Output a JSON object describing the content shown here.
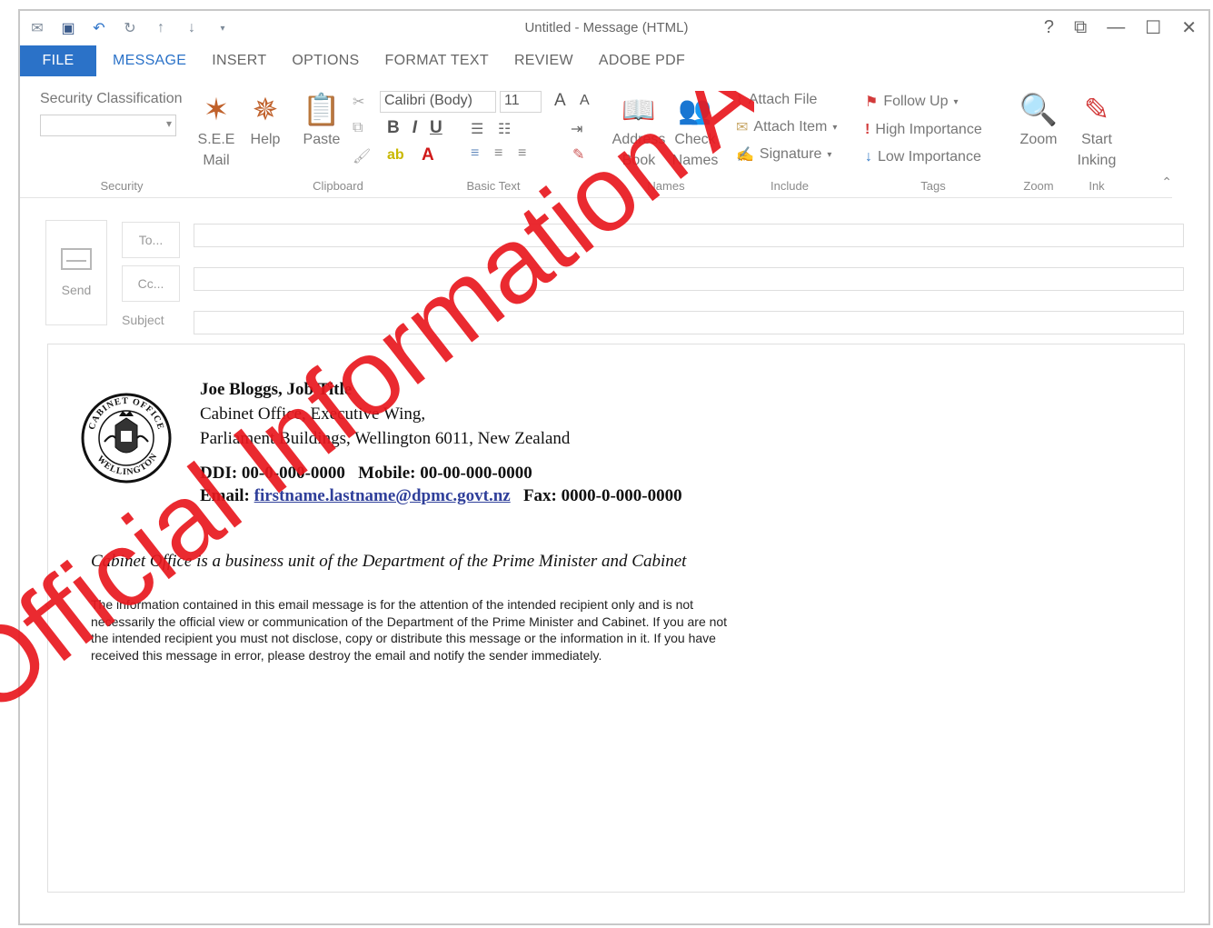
{
  "window": {
    "title": "Untitled - Message (HTML)",
    "controls": [
      "?",
      "⧉",
      "—",
      "☐",
      "✕"
    ]
  },
  "quick_access": [
    "envelope-icon",
    "save-icon",
    "undo-icon",
    "redo-icon",
    "up-arrow-icon",
    "down-arrow-icon",
    "customize-icon"
  ],
  "tabs": [
    {
      "label": "FILE"
    },
    {
      "label": "MESSAGE"
    },
    {
      "label": "INSERT"
    },
    {
      "label": "OPTIONS"
    },
    {
      "label": "FORMAT TEXT"
    },
    {
      "label": "REVIEW"
    },
    {
      "label": "ADOBE PDF"
    }
  ],
  "ribbon": {
    "security": {
      "classification_label": "Security Classification",
      "classification_value": "",
      "see_mail": "S.E.E\nMail",
      "help": "Help",
      "group": "Security"
    },
    "clipboard": {
      "paste": "Paste",
      "group": "Clipboard"
    },
    "basic_text": {
      "font": "Calibri (Body)",
      "size": "11",
      "bold": "B",
      "italic": "I",
      "underline": "U",
      "group": "Basic Text"
    },
    "names": {
      "address_book": "Address\nBook",
      "check_names": "Check\nNames",
      "group": "Names"
    },
    "include": {
      "attach_file": "Attach File",
      "attach_item": "Attach Item",
      "signature": "Signature",
      "group": "Include"
    },
    "tags": {
      "follow_up": "Follow Up",
      "high_importance": "High Importance",
      "low_importance": "Low Importance",
      "group": "Tags"
    },
    "zoom": {
      "zoom": "Zoom",
      "group": "Zoom"
    },
    "ink": {
      "start_inking": "Start\nInking",
      "group": "Ink"
    }
  },
  "compose": {
    "send": "Send",
    "to": "To...",
    "cc": "Cc...",
    "subject": "Subject",
    "to_value": "",
    "cc_value": "",
    "subject_value": ""
  },
  "signature": {
    "name_title": "Joe Bloggs, Job Title",
    "line1": "Cabinet Office, Executive Wing,",
    "line2": "Parliament Buildings, Wellington 6011, New Zealand",
    "ddi_label": "DDI:",
    "ddi": "00-0-000-0000",
    "mobile_label": "Mobile:",
    "mobile": "00-00-000-0000",
    "email_label": "Email:",
    "email": "firstname.lastname@dpmc.govt.nz",
    "fax_label": "Fax:",
    "fax": "0000-0-000-0000",
    "seal_top": "CABINET OFFICE",
    "seal_bottom": "WELLINGTON"
  },
  "unit_statement": "Cabinet Office is a business unit of the Department of the Prime Minister and Cabinet",
  "disclaimer": "The information contained in this email message is for the attention of the intended recipient only and is not necessarily the official view or communication of the Department of the Prime Minister and Cabinet. If you are not the intended recipient you must not disclose, copy or distribute this message or the information in it. If you have received this message in error, please destroy the email and notify the sender immediately.",
  "watermark": "Official Information Act",
  "colors": {
    "accent": "#2b72c8",
    "watermark": "#e8181e",
    "link": "#2f3f9a"
  }
}
